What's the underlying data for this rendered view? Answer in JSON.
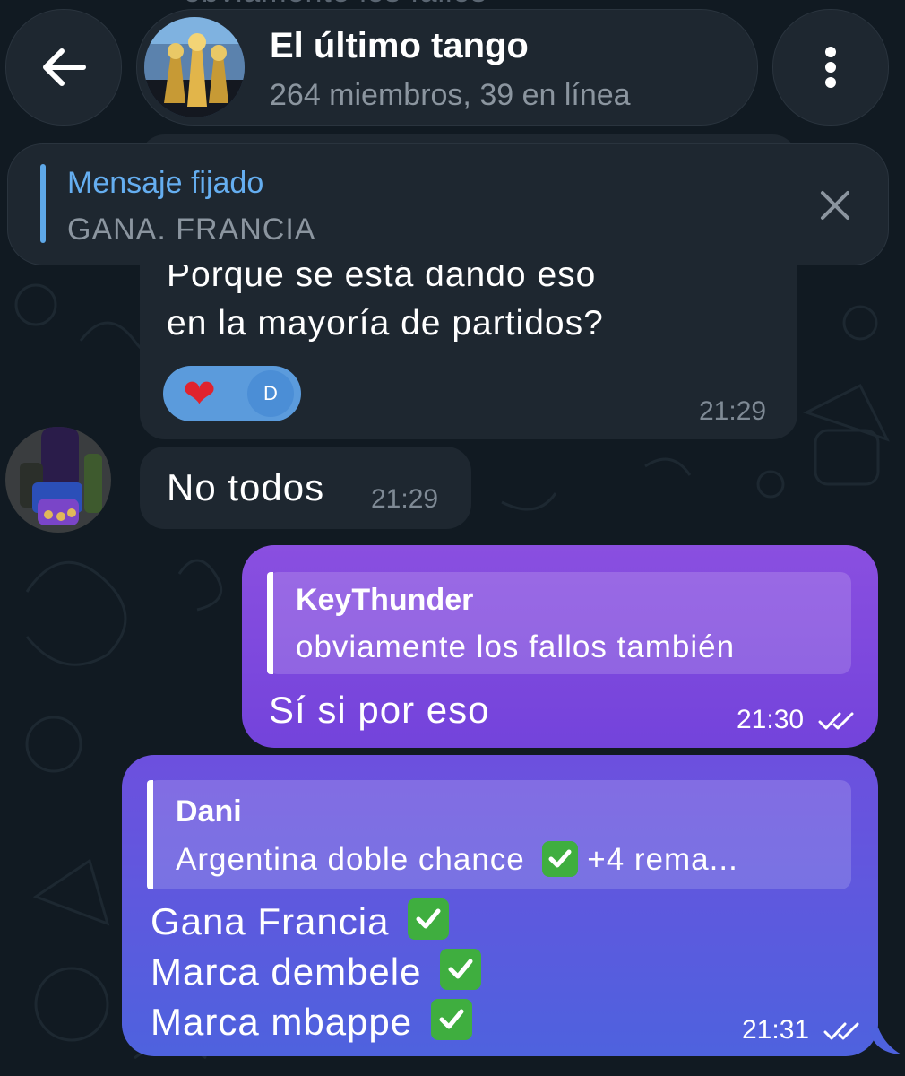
{
  "header": {
    "back_icon": "arrow-left-icon",
    "title": "El último tango",
    "subtitle": "264 miembros, 39 en línea",
    "menu_icon": "more-vertical-icon",
    "behind_text": "obviamente los fallos"
  },
  "pinned": {
    "label": "Mensaje fijado",
    "text": "GANA. FRANCIA",
    "close_icon": "close-icon"
  },
  "messages": [
    {
      "direction": "incoming",
      "text_line1": "Porque se está dando eso",
      "text_line2": "en la mayoría de partidos?",
      "reaction_emoji": "❤",
      "reaction_user_initial": "D",
      "time": "21:29"
    },
    {
      "direction": "incoming",
      "text": "No todos",
      "time": "21:29"
    },
    {
      "direction": "outgoing",
      "reply_name": "KeyThunder",
      "reply_text": "obviamente los fallos también",
      "text": "Sí si por eso",
      "time": "21:30"
    },
    {
      "direction": "outgoing",
      "reply_name": "Dani",
      "reply_text_before": "Argentina doble chance",
      "reply_text_after": "+4 rema...",
      "line1": "Gana Francia",
      "line2": "Marca dembele",
      "line3": "Marca mbappe",
      "time": "21:31"
    }
  ],
  "colors": {
    "background": "#111a22",
    "bubble_in": "#1e2730",
    "bubble_out_top": "#8a4fe0",
    "bubble_out_bottom": "#4e62de",
    "accent_blue": "#65aef0",
    "check_green": "#3fae3f"
  }
}
